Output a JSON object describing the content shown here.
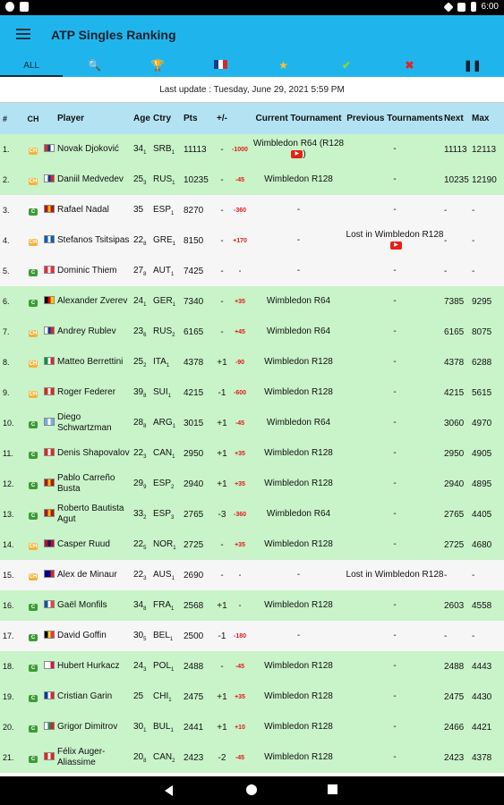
{
  "statusbar": {
    "time": "6:00"
  },
  "app": {
    "title": "ATP Singles Ranking"
  },
  "tabs": [
    {
      "label": "ALL",
      "icon": ""
    },
    {
      "label": "",
      "icon": "search-icon"
    },
    {
      "label": "",
      "icon": "trophy-icon"
    },
    {
      "label": "",
      "icon": "flag-icon"
    },
    {
      "label": "",
      "icon": "star-icon"
    },
    {
      "label": "",
      "icon": "check-icon"
    },
    {
      "label": "",
      "icon": "close-icon"
    },
    {
      "label": "",
      "icon": "pause-icon"
    }
  ],
  "update_text": "Last update : Tuesday, June 29, 2021 5:59 PM",
  "headers": {
    "rank": "#",
    "ch": "CH",
    "player": "Player",
    "age": "Age",
    "ctry": "Ctry",
    "pts": "Pts",
    "pm": "+/-",
    "cur": "Current Tournament",
    "prev": "Previous Tournaments",
    "next": "Next",
    "max": "Max"
  },
  "rows": [
    {
      "rank": "1.",
      "ch": "CH",
      "player": "Novak Djoković",
      "age": "34",
      "age_sub": "1",
      "ctry": "SRB",
      "ctry_sub": "1",
      "pts": "11113",
      "pm": "-",
      "delta": "-1000",
      "cur": "Wimbledon R64 (R128",
      "cur_yt": true,
      "cur_suffix": ")",
      "prev": "-",
      "next": "11113",
      "max": "12113",
      "bg": "green"
    },
    {
      "rank": "2.",
      "ch": "CH",
      "player": "Daniil Medvedev",
      "age": "25",
      "age_sub": "3",
      "ctry": "RUS",
      "ctry_sub": "1",
      "pts": "10235",
      "pm": "-",
      "delta": "-45",
      "cur": "Wimbledon R128",
      "prev": "-",
      "next": "10235",
      "max": "12190",
      "bg": "green"
    },
    {
      "rank": "3.",
      "ch": "C",
      "player": "Rafael Nadal",
      "age": "35",
      "age_sub": "",
      "ctry": "ESP",
      "ctry_sub": "1",
      "pts": "8270",
      "pm": "-",
      "delta": "-360",
      "cur": "-",
      "prev": "-",
      "next": "-",
      "max": "-",
      "bg": "white"
    },
    {
      "rank": "4.",
      "ch": "CH",
      "player": "Stefanos Tsitsipas",
      "age": "22",
      "age_sub": "8",
      "ctry": "GRE",
      "ctry_sub": "1",
      "pts": "8150",
      "pm": "-",
      "delta": "+170",
      "cur": "-",
      "prev": "Lost in Wimbledon R128",
      "prev_yt": true,
      "next": "-",
      "max": "-",
      "bg": "white"
    },
    {
      "rank": "5.",
      "ch": "C",
      "player": "Dominic Thiem",
      "age": "27",
      "age_sub": "8",
      "ctry": "AUT",
      "ctry_sub": "1",
      "pts": "7425",
      "pm": "-",
      "delta": "-",
      "cur": "-",
      "prev": "-",
      "next": "-",
      "max": "-",
      "bg": "white"
    },
    {
      "rank": "6.",
      "ch": "C",
      "player": "Alexander Zverev",
      "age": "24",
      "age_sub": "1",
      "ctry": "GER",
      "ctry_sub": "1",
      "pts": "7340",
      "pm": "-",
      "delta": "+35",
      "cur": "Wimbledon R64",
      "prev": "-",
      "next": "7385",
      "max": "9295",
      "bg": "green"
    },
    {
      "rank": "7.",
      "ch": "CH",
      "player": "Andrey Rublev",
      "age": "23",
      "age_sub": "6",
      "ctry": "RUS",
      "ctry_sub": "2",
      "pts": "6165",
      "pm": "-",
      "delta": "+45",
      "cur": "Wimbledon R64",
      "prev": "-",
      "next": "6165",
      "max": "8075",
      "bg": "green"
    },
    {
      "rank": "8.",
      "ch": "CH",
      "player": "Matteo Berrettini",
      "age": "25",
      "age_sub": "2",
      "ctry": "ITA",
      "ctry_sub": "1",
      "pts": "4378",
      "pm": "+1",
      "delta": "-90",
      "cur": "Wimbledon R128",
      "prev": "-",
      "next": "4378",
      "max": "6288",
      "bg": "green"
    },
    {
      "rank": "9.",
      "ch": "CH",
      "player": "Roger Federer",
      "age": "39",
      "age_sub": "8",
      "ctry": "SUI",
      "ctry_sub": "1",
      "pts": "4215",
      "pm": "-1",
      "delta": "-600",
      "cur": "Wimbledon R128",
      "prev": "-",
      "next": "4215",
      "max": "5615",
      "bg": "green"
    },
    {
      "rank": "10.",
      "ch": "C",
      "player": "Diego Schwartzman",
      "age": "28",
      "age_sub": "8",
      "ctry": "ARG",
      "ctry_sub": "1",
      "pts": "3015",
      "pm": "+1",
      "delta": "-45",
      "cur": "Wimbledon R64",
      "prev": "-",
      "next": "3060",
      "max": "4970",
      "bg": "green"
    },
    {
      "rank": "11.",
      "ch": "C",
      "player": "Denis Shapovalov",
      "age": "22",
      "age_sub": "3",
      "ctry": "CAN",
      "ctry_sub": "1",
      "pts": "2950",
      "pm": "+1",
      "delta": "+35",
      "cur": "Wimbledon R128",
      "prev": "-",
      "next": "2950",
      "max": "4905",
      "bg": "green"
    },
    {
      "rank": "12.",
      "ch": "C",
      "player": "Pablo Carreño Busta",
      "age": "29",
      "age_sub": "9",
      "ctry": "ESP",
      "ctry_sub": "2",
      "pts": "2940",
      "pm": "+1",
      "delta": "+35",
      "cur": "Wimbledon R128",
      "prev": "-",
      "next": "2940",
      "max": "4895",
      "bg": "green"
    },
    {
      "rank": "13.",
      "ch": "C",
      "player": "Roberto Bautista Agut",
      "age": "33",
      "age_sub": "2",
      "ctry": "ESP",
      "ctry_sub": "3",
      "pts": "2765",
      "pm": "-3",
      "delta": "-360",
      "cur": "Wimbledon R64",
      "prev": "-",
      "next": "2765",
      "max": "4405",
      "bg": "green"
    },
    {
      "rank": "14.",
      "ch": "CH",
      "player": "Casper Ruud",
      "age": "22",
      "age_sub": "5",
      "ctry": "NOR",
      "ctry_sub": "1",
      "pts": "2725",
      "pm": "-",
      "delta": "+35",
      "cur": "Wimbledon R128",
      "prev": "-",
      "next": "2725",
      "max": "4680",
      "bg": "green"
    },
    {
      "rank": "15.",
      "ch": "CH",
      "player": "Alex de Minaur",
      "age": "22",
      "age_sub": "3",
      "ctry": "AUS",
      "ctry_sub": "1",
      "pts": "2690",
      "pm": "-",
      "delta": "-",
      "cur": "-",
      "prev": "Lost in Wimbledon R128",
      "next": "-",
      "max": "-",
      "bg": "white"
    },
    {
      "rank": "16.",
      "ch": "C",
      "player": "Gaël Monfils",
      "age": "34",
      "age_sub": "8",
      "ctry": "FRA",
      "ctry_sub": "1",
      "pts": "2568",
      "pm": "+1",
      "delta": "-",
      "cur": "Wimbledon R128",
      "prev": "-",
      "next": "2603",
      "max": "4558",
      "bg": "green"
    },
    {
      "rank": "17.",
      "ch": "C",
      "player": "David Goffin",
      "age": "30",
      "age_sub": "5",
      "ctry": "BEL",
      "ctry_sub": "1",
      "pts": "2500",
      "pm": "-1",
      "delta": "-180",
      "cur": "-",
      "prev": "-",
      "next": "-",
      "max": "-",
      "bg": "white"
    },
    {
      "rank": "18.",
      "ch": "C",
      "player": "Hubert Hurkacz",
      "age": "24",
      "age_sub": "3",
      "ctry": "POL",
      "ctry_sub": "1",
      "pts": "2488",
      "pm": "-",
      "delta": "-45",
      "cur": "Wimbledon R128",
      "prev": "-",
      "next": "2488",
      "max": "4443",
      "bg": "green"
    },
    {
      "rank": "19.",
      "ch": "C",
      "player": "Cristian Garin",
      "age": "25",
      "age_sub": "",
      "ctry": "CHI",
      "ctry_sub": "1",
      "pts": "2475",
      "pm": "+1",
      "delta": "+35",
      "cur": "Wimbledon R128",
      "prev": "-",
      "next": "2475",
      "max": "4430",
      "bg": "green"
    },
    {
      "rank": "20.",
      "ch": "C",
      "player": "Grigor Dimitrov",
      "age": "30",
      "age_sub": "1",
      "ctry": "BUL",
      "ctry_sub": "1",
      "pts": "2441",
      "pm": "+1",
      "delta": "+10",
      "cur": "Wimbledon R128",
      "prev": "-",
      "next": "2466",
      "max": "4421",
      "bg": "green"
    },
    {
      "rank": "21.",
      "ch": "C",
      "player": "Félix Auger-Aliassime",
      "age": "20",
      "age_sub": "8",
      "ctry": "CAN",
      "ctry_sub": "2",
      "pts": "2423",
      "pm": "-2",
      "delta": "-45",
      "cur": "Wimbledon R128",
      "prev": "-",
      "next": "2423",
      "max": "4378",
      "bg": "green"
    }
  ]
}
